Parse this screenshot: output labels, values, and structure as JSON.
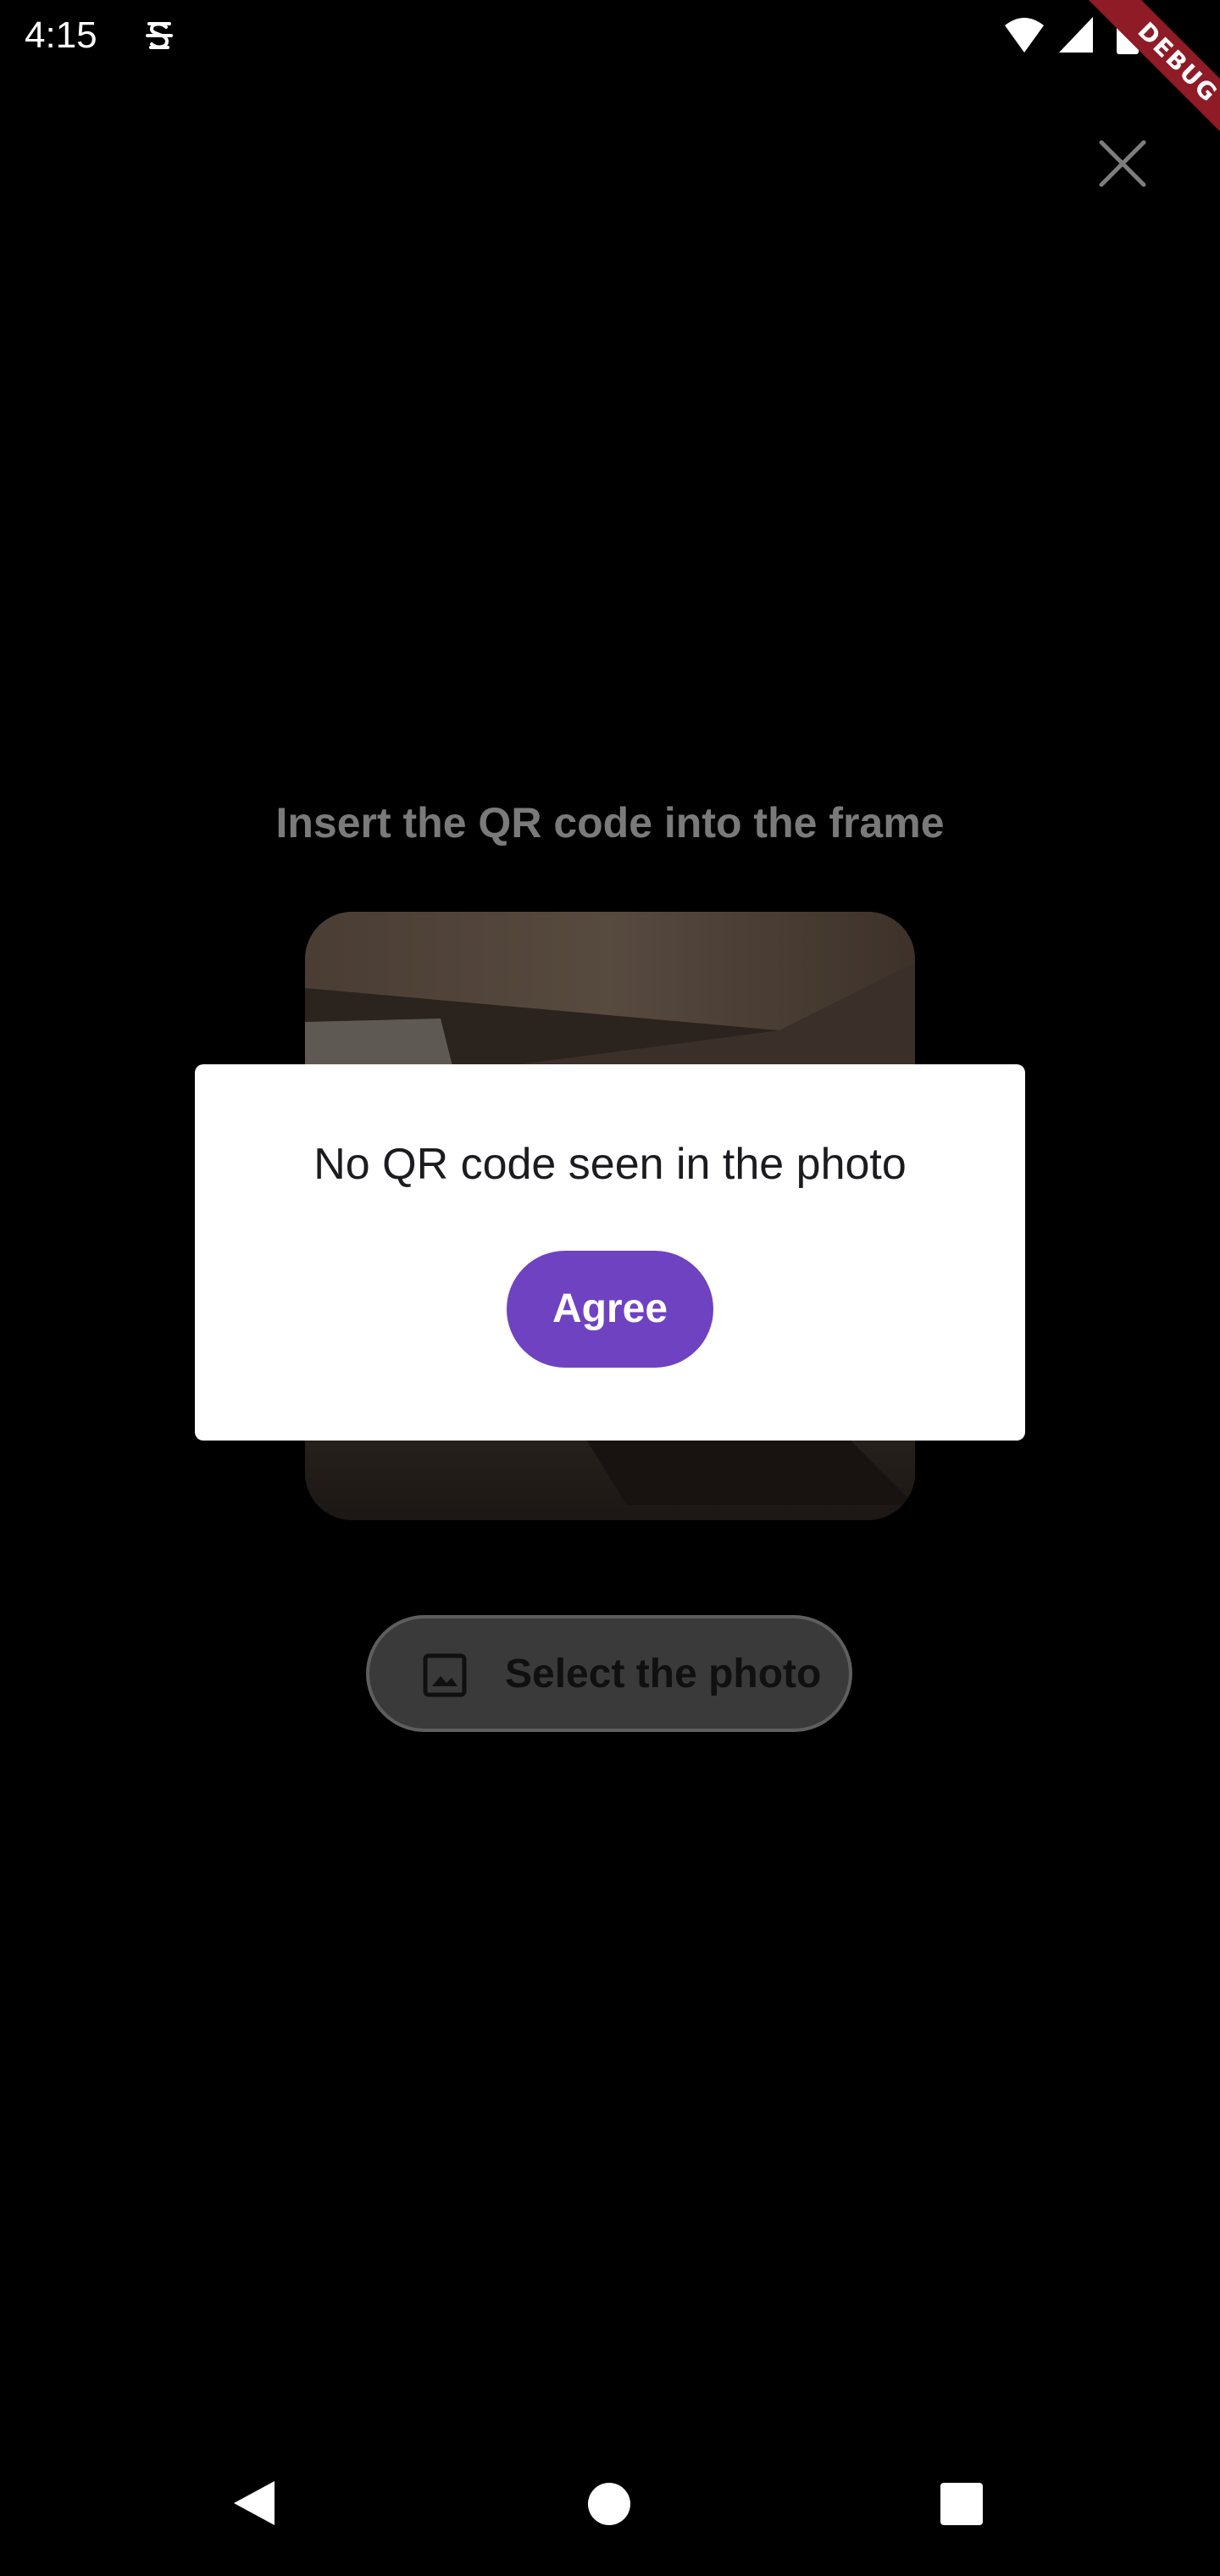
{
  "status_bar": {
    "time": "4:15",
    "icons": [
      "app-notification-icon",
      "wifi-icon",
      "cellular-signal-icon",
      "battery-icon"
    ]
  },
  "debug_banner": {
    "label": "DEBUG"
  },
  "scanner": {
    "close_icon": "close-icon",
    "instruction": "Insert the QR code into the frame",
    "select_photo": {
      "icon": "image-icon",
      "label": "Select the photo"
    }
  },
  "dialog": {
    "message": "No QR code seen in the photo",
    "agree_label": "Agree"
  },
  "navigation_bar": {
    "icons": [
      "back-icon",
      "home-icon",
      "recents-icon"
    ]
  },
  "colors": {
    "background": "#000000",
    "dialog_background": "#ffffff",
    "primary": "#6f42c1",
    "debug_banner": "#8e1b26",
    "dimmed_text": "#7a7a7a"
  }
}
